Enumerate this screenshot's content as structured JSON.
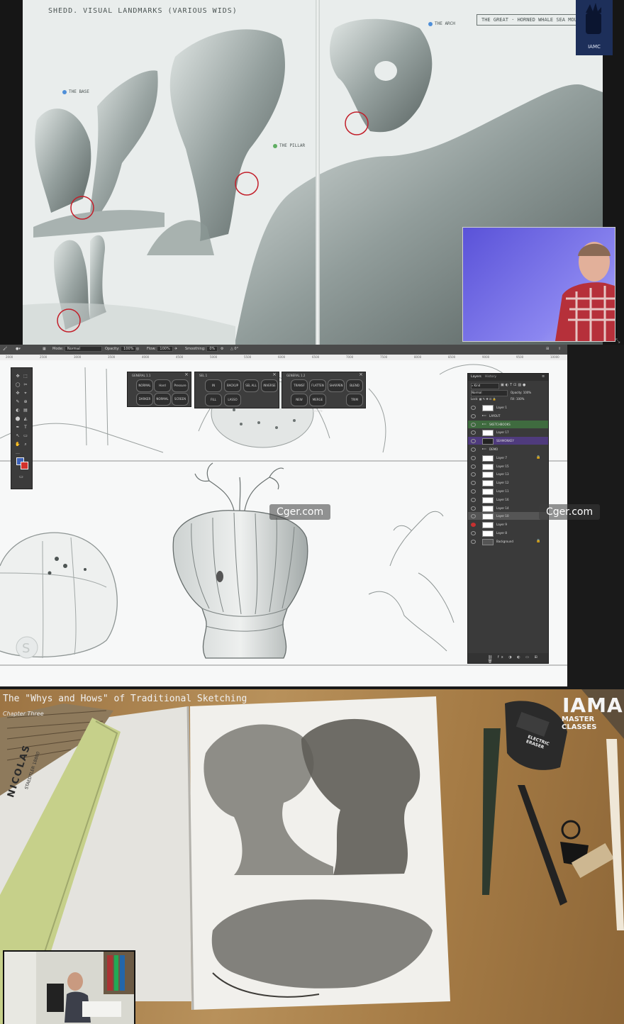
{
  "panel_sketchbook": {
    "title": "SHEDD. VISUAL LANDMARKS (VARIOUS WIDS)",
    "box_label": "THE GREAT · HORNED WHALE SEA MOUNT",
    "notes": [
      "THE ARCH",
      "THE BASE",
      "THE PILLAR"
    ],
    "logo_text": "IAMC"
  },
  "panel_photoshop": {
    "options": {
      "mode_label": "Mode:",
      "mode_value": "Normal",
      "opacity_label": "Opacity:",
      "opacity_value": "100%",
      "flow_label": "Flow:",
      "flow_value": "100%",
      "smoothing_label": "Smoothing:",
      "smoothing_value": "0%"
    },
    "ruler": [
      "2000",
      "2500",
      "3000",
      "3500",
      "4000",
      "4500",
      "5000",
      "5500",
      "6000",
      "6500",
      "7000",
      "7500",
      "8000",
      "8500",
      "9000",
      "9500",
      "10000"
    ],
    "panel1": {
      "title": "GENERAL 1.1",
      "buttons": [
        "NORMAL",
        "Hard Round",
        "Pressure",
        "DARKER",
        "NORMAL",
        "SCREEN"
      ]
    },
    "panel2": {
      "title": "SEL 1",
      "buttons": [
        "IN",
        "BACKUP",
        "SEL ALL",
        "INVERSE",
        "FILL",
        "LASSO"
      ]
    },
    "panel3": {
      "title": "GENERAL 1.2",
      "buttons": [
        "TRANSF",
        "FLATTEN",
        "SHARPEN",
        "BLEND",
        "NEW",
        "MERGE DOWN",
        "TRIM"
      ]
    },
    "layers_panel": {
      "tabs": [
        "Layers",
        "History"
      ],
      "kind_label": "Kind",
      "blend": "Normal",
      "opacity_label": "Opacity:",
      "opacity_value": "100%",
      "lock_label": "Lock:",
      "fill_label": "Fill:",
      "fill_value": "100%",
      "layers": [
        {
          "name": "Layer 1"
        },
        {
          "name": "LAYOUT"
        },
        {
          "name": "SKETCHBOOKS"
        },
        {
          "name": "Layer 17"
        },
        {
          "name": "SEAMONKEY"
        },
        {
          "name": "DEMO"
        },
        {
          "name": "Layer 7"
        },
        {
          "name": "Layer 15"
        },
        {
          "name": "Layer 13"
        },
        {
          "name": "Layer 12"
        },
        {
          "name": "Layer 11"
        },
        {
          "name": "Layer 16"
        },
        {
          "name": "Layer 14"
        },
        {
          "name": "Layer 10"
        },
        {
          "name": "Layer 9"
        },
        {
          "name": "Layer 8"
        },
        {
          "name": "Background"
        }
      ]
    },
    "watermark": "Cger.com"
  },
  "panel_desk": {
    "title": "The \"Whys and Hows\" of Traditional Sketching",
    "chapter": "Chapter Three",
    "brand_line1": "IAMAG",
    "brand_line2": "MASTER CLASSES",
    "brush_label": "NICOLAS",
    "brush_label2": "STAEDTLER 18800",
    "eraser_label": "ELECTRIC ERASER"
  }
}
